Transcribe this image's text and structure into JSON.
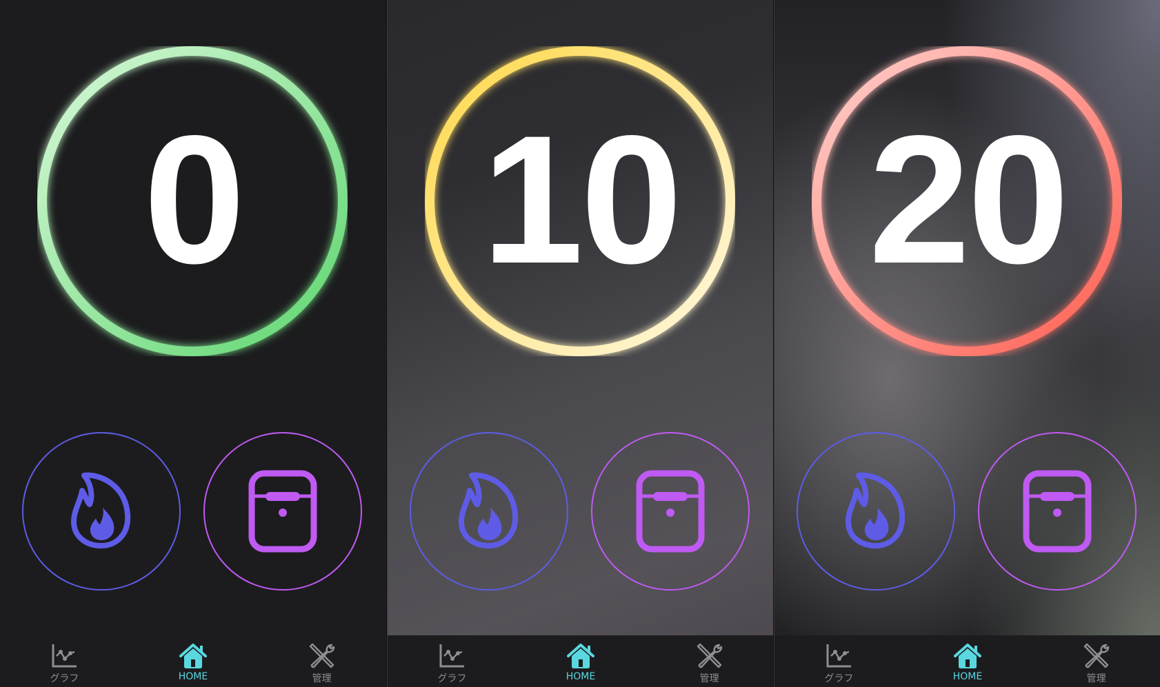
{
  "screens": [
    {
      "value": "0",
      "ring_colors": [
        "#d8f8d8",
        "#5ed670"
      ]
    },
    {
      "value": "10",
      "ring_colors": [
        "#ffd84a",
        "#fff8e0"
      ]
    },
    {
      "value": "20",
      "ring_colors": [
        "#ffd0cc",
        "#ff5f52"
      ]
    }
  ],
  "buttons": {
    "fire_icon": "flame-icon",
    "case_icon": "airpods-case-icon",
    "fire_color": "#5e5ce6",
    "case_color": "#bf5af2"
  },
  "tabbar": {
    "items": [
      {
        "label": "グラフ",
        "icon": "chart-icon"
      },
      {
        "label": "HOME",
        "icon": "house-icon",
        "active": true
      },
      {
        "label": "管理",
        "icon": "tools-icon"
      }
    ],
    "active_color": "#5ad8e0",
    "inactive_color": "#8e8e93"
  }
}
